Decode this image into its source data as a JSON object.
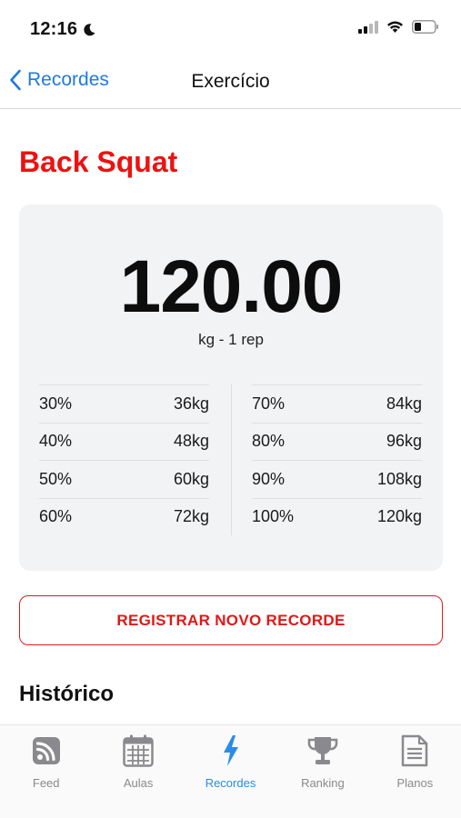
{
  "status_bar": {
    "time": "12:16"
  },
  "nav": {
    "back_label": "Recordes",
    "title": "Exercício"
  },
  "exercise": {
    "name": "Back Squat"
  },
  "record": {
    "value": "120.00",
    "unit_text": "kg - 1 rep"
  },
  "percentages": {
    "left": [
      {
        "pct": "30%",
        "weight": "36kg"
      },
      {
        "pct": "40%",
        "weight": "48kg"
      },
      {
        "pct": "50%",
        "weight": "60kg"
      },
      {
        "pct": "60%",
        "weight": "72kg"
      }
    ],
    "right": [
      {
        "pct": "70%",
        "weight": "84kg"
      },
      {
        "pct": "80%",
        "weight": "96kg"
      },
      {
        "pct": "90%",
        "weight": "108kg"
      },
      {
        "pct": "100%",
        "weight": "120kg"
      }
    ]
  },
  "actions": {
    "register_label": "REGISTRAR NOVO RECORDE"
  },
  "history": {
    "heading": "Histórico"
  },
  "tabs": [
    {
      "label": "Feed",
      "icon": "feed-icon"
    },
    {
      "label": "Aulas",
      "icon": "calendar-icon"
    },
    {
      "label": "Recordes",
      "icon": "bolt-icon",
      "active": true
    },
    {
      "label": "Ranking",
      "icon": "trophy-icon"
    },
    {
      "label": "Planos",
      "icon": "document-icon"
    }
  ],
  "colors": {
    "accent_red": "#ee1111",
    "link_blue": "#1f7ae0",
    "tab_active": "#2a8ce8",
    "tab_inactive": "#8a8a8e",
    "card_bg": "#f2f3f5"
  }
}
